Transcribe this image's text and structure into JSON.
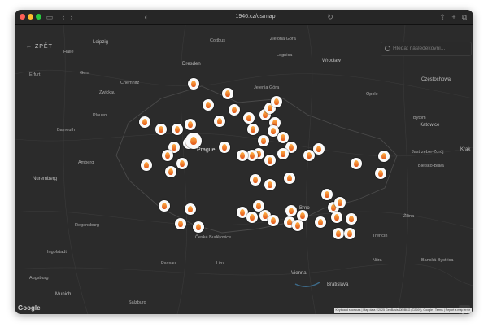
{
  "browser": {
    "url": "1946.cz/cs/map",
    "lights": [
      "#ff5f57",
      "#febc2e",
      "#28c840"
    ]
  },
  "app": {
    "back_label": "ZPĚT",
    "search_placeholder": "Hledat následekovní...",
    "attribution": [
      "Keyboard shortcuts",
      "Map data ©2025 GeoBasis-DE/BKG (©2009), Google",
      "Terms",
      "Report a map error"
    ],
    "google": "Google",
    "fullscreen_icon": "fullscreen-icon"
  },
  "map_labels": {
    "leipzig": "Leipzig",
    "dresden": "Dresden",
    "wroclaw": "Wrocław",
    "czestochowa": "Częstochowa",
    "prague": "Prague",
    "nuremberg": "Nuremberg",
    "regensburg": "Regensburg",
    "munich": "Munich",
    "vienna": "Vienna",
    "bratislava": "Bratislava",
    "brno": "Brno",
    "katowice": "Katowice",
    "chemnitz": "Chemnitz",
    "zwickau": "Zwickau",
    "gera": "Gera",
    "erfurt": "Erfurt",
    "cottbus": "Cottbus",
    "zielona_gora": "Zielona Góra",
    "legnica": "Legnica",
    "opole": "Opole",
    "bytom": "Bytom",
    "augsburg": "Augsburg",
    "salzburg": "Salzburg",
    "linz": "Linz",
    "zilina": "Žilina",
    "trencin": "Trenčín",
    "nitra": "Nitra",
    "ingolstadt": "Ingolstadt",
    "passau": "Passau",
    "halle": "Halle",
    "jelenia_gora": "Jelenia Góra",
    "plauen": "Plauen",
    "bayreuth": "Bayreuth",
    "amberg": "Amberg",
    "krak": "Krak",
    "bielsko": "Bielsko-Biała",
    "ceska": "České Budějovice",
    "jastrzebie": "Jastrzębie-Zdrój",
    "banska": "Banská Bystrica"
  }
}
